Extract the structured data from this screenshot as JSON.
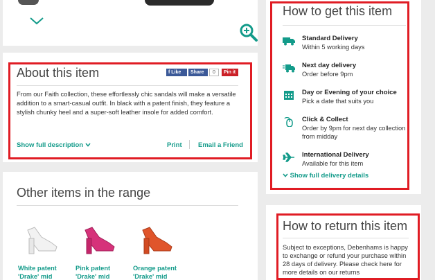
{
  "colors": {
    "accent": "#139b8a",
    "highlight": "#e01c24",
    "facebook": "#3b5998",
    "pinterest": "#cb2027"
  },
  "about": {
    "title": "About this item",
    "description": "From our Faith collection, these effortlessly chic sandals will make a versatile addition to a smart-casual outfit. In black with a patent finish, they feature a stylish chunky heel and a super-soft leather insole for added comfort.",
    "show_full": "Show full description",
    "print": "Print",
    "email": "Email a Friend",
    "social": {
      "like": "Like",
      "share": "Share",
      "count": "0",
      "pin": "Pin it"
    }
  },
  "range": {
    "title": "Other items in the range",
    "items": [
      {
        "name": "White patent 'Drake' mid",
        "color": "#f2f2f2"
      },
      {
        "name": "Pink patent 'Drake' mid",
        "color": "#d6327a"
      },
      {
        "name": "Orange patent 'Drake' mid",
        "color": "#e0552b"
      }
    ]
  },
  "delivery": {
    "title": "How to get this item",
    "options": [
      {
        "title": "Standard Delivery",
        "detail": "Within 5 working days",
        "icon": "truck-icon"
      },
      {
        "title": "Next day delivery",
        "detail": "Order before 9pm",
        "icon": "fast-truck-icon"
      },
      {
        "title": "Day or Evening of your choice",
        "detail": "Pick a date that suits you",
        "icon": "calendar-icon"
      },
      {
        "title": "Click & Collect",
        "detail": "Order by 9pm for next day collection from midday",
        "icon": "mouse-icon"
      },
      {
        "title": "International Delivery",
        "detail": "Available for this item",
        "icon": "plane-icon"
      }
    ],
    "show_full": "Show full delivery details"
  },
  "returns": {
    "title": "How to return this item",
    "text": "Subject to exceptions, Debenhams is happy to exchange or refund your purchase within 28 days of delivery. Please check here for more details on our returns"
  }
}
